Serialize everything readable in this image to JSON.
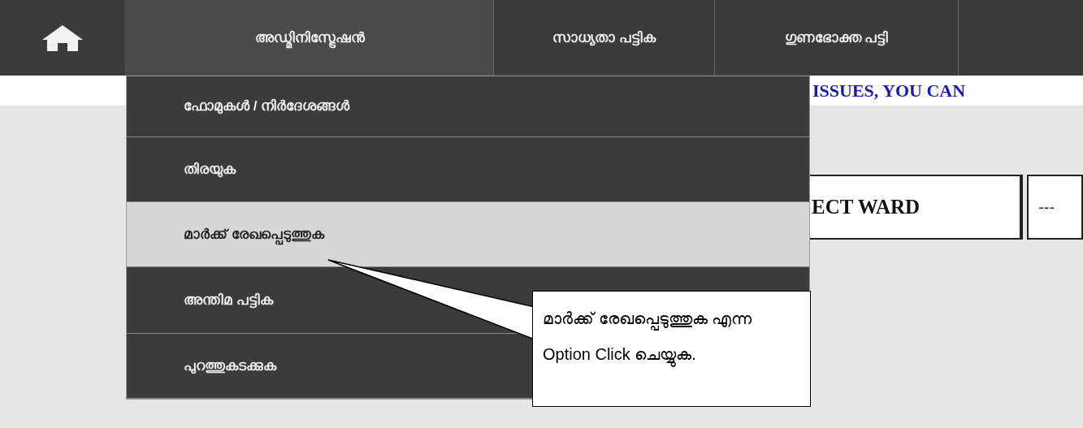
{
  "nav": {
    "items": [
      {
        "label": "അഡ്മിനിസ്ട്രേഷൻ",
        "selected": true
      },
      {
        "label": "സാധ്യതാ പട്ടിക",
        "selected": false
      },
      {
        "label": "ഗുണഭോക്ത പട്ടി",
        "selected": false
      }
    ]
  },
  "notice": "ISSUES, YOU CAN",
  "ward_selector": {
    "label": "ECT WARD",
    "value": "---"
  },
  "dropdown": {
    "items": [
      {
        "label": "ഫോമുകൾ / നിർദേശങ്ങൾ",
        "selected": false
      },
      {
        "label": "തിരയുക",
        "selected": false
      },
      {
        "label": "മാർക്ക് രേഖപ്പെടുത്തുക",
        "selected": true
      },
      {
        "label": "അന്തിമ പട്ടിക",
        "selected": false
      },
      {
        "label": "പുറത്തുകടക്കുക",
        "selected": false
      }
    ]
  },
  "callout": {
    "lines": [
      "മാർക്ക് രേഖപ്പെടുത്തുക എന്ന",
      "Option Click ചെയ്യുക."
    ]
  }
}
